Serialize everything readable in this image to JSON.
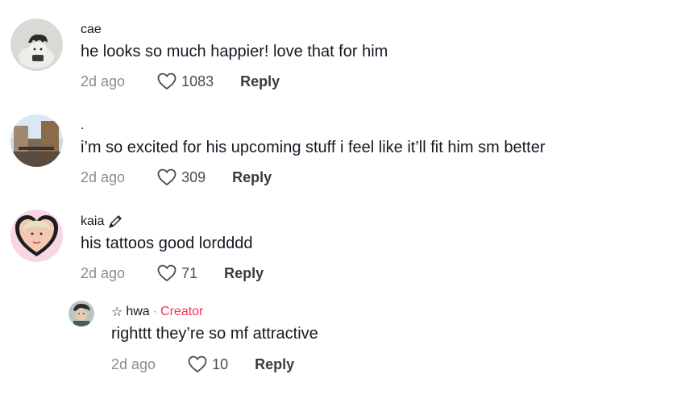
{
  "comments": [
    {
      "username": "cae",
      "text": "he looks so much happier! love that for him",
      "time": "2d ago",
      "likes": "1083",
      "reply_label": "Reply"
    },
    {
      "username": ".",
      "text": "i’m so excited for his upcoming stuff i feel like it’ll fit him sm better",
      "time": "2d ago",
      "likes": "309",
      "reply_label": "Reply"
    },
    {
      "username": "kaia",
      "username_emoji": "pen-icon",
      "text": "his tattoos good lordddd",
      "time": "2d ago",
      "likes": "71",
      "reply_label": "Reply"
    }
  ],
  "reply": {
    "star": "☆",
    "username": "hwa",
    "separator": "·",
    "badge": "Creator",
    "text": "righttt they’re so mf attractive",
    "time": "2d ago",
    "likes": "10",
    "reply_label": "Reply"
  },
  "colors": {
    "creator": "#fe2c55",
    "muted": "#8a8b91",
    "text": "#161823"
  }
}
